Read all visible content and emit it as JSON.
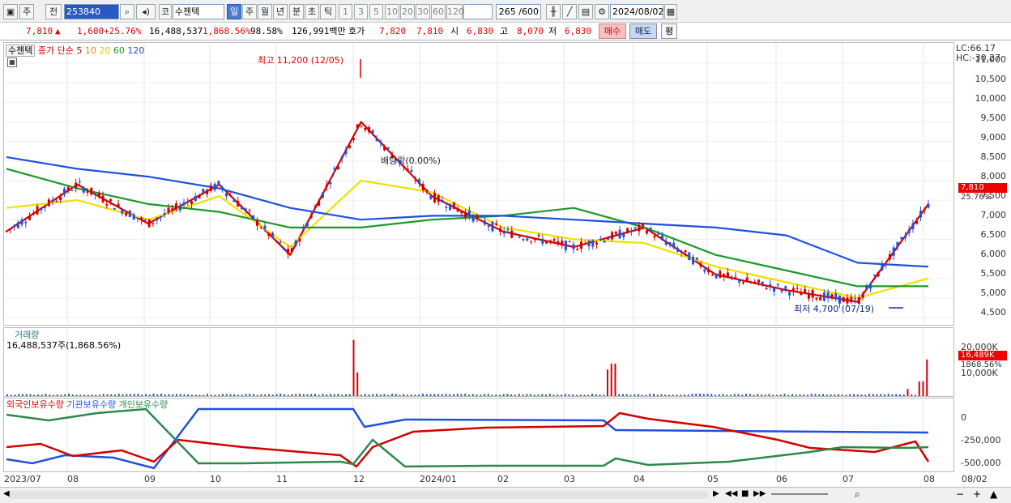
{
  "toolbar": {
    "market_label": "주",
    "prev_label": "전",
    "code_value": "253840",
    "market_type": "코",
    "stock_name": "수젠텍",
    "periods": [
      "일",
      "주",
      "월",
      "년",
      "분",
      "초",
      "틱"
    ],
    "selected_period": "일",
    "intervals": [
      "1",
      "3",
      "5",
      "10",
      "20",
      "30",
      "60",
      "120"
    ],
    "count_display": "265 /600",
    "date_value": "2024/08/02"
  },
  "quote": {
    "price": "7,810",
    "arrow": "▲",
    "change": "1,600",
    "change_pct": "+25.76%",
    "volume": "16,488,537",
    "volume_pct": "1,868.56%",
    "turnover_ratio": "98.58%",
    "amount": "126,991백만",
    "hoga_label": "호가",
    "hoga_bid": "7,820",
    "hoga_ask": "7,810",
    "open_label": "시",
    "open": "6,830",
    "high_label": "고",
    "high": "8,070",
    "low_label": "저",
    "low": "6,830",
    "buy_label": "매수",
    "sell_label": "매도",
    "avg_label": "평"
  },
  "price_panel": {
    "name_tag": "수젠텍",
    "ma_label": "종가 단순",
    "ma_periods": [
      "5",
      "10",
      "20",
      "60",
      "120"
    ],
    "ma_colors": [
      "#d40000",
      "#e08a00",
      "#f0e000",
      "#1a9a2a",
      "#2050e0"
    ],
    "high_note": "최고 11,200 (12/05)",
    "low_note": "최저 4,700 (07/19)",
    "ex_note": "배당락(0.00%)",
    "lc": "LC:66.17",
    "hc": "HC:-30.27",
    "y_ticks": [
      "11,000",
      "10,500",
      "10,000",
      "9,500",
      "9,000",
      "8,500",
      "8,000",
      "7,500",
      "7,000",
      "6,500",
      "6,000",
      "5,500",
      "5,000",
      "4,500"
    ],
    "last_price_tag": "7,810",
    "last_pct_tag": "25.76%"
  },
  "volume_panel": {
    "title": "거래량",
    "value_text": "16,488,537주(1,868.56%)",
    "y_ticks": [
      "20,000K",
      "10,000K"
    ],
    "last_tag": "16,489K",
    "last_pct": "1868.56%"
  },
  "holding_panel": {
    "series": [
      {
        "name": "외국인보유수량",
        "color": "#d40000"
      },
      {
        "name": "기관보유수량",
        "color": "#2050e0"
      },
      {
        "name": "개인보유수량",
        "color": "#2a8a4a"
      }
    ],
    "y_ticks": [
      "0",
      "-250,000",
      "-500,000"
    ]
  },
  "x_axis": [
    "2023/07",
    "08",
    "09",
    "10",
    "11",
    "12",
    "2024/01",
    "02",
    "03",
    "04",
    "05",
    "06",
    "07",
    "08"
  ],
  "x_axis_right": "08/02",
  "chart_data": {
    "type": "line",
    "title": "",
    "note": "daily candlestick with moving averages (values approximate)",
    "ylim": [
      4500,
      11200
    ],
    "x": [
      "2023/07",
      "08",
      "09",
      "10",
      "11",
      "12",
      "2024/01",
      "02",
      "03",
      "04",
      "05",
      "06",
      "07",
      "08"
    ],
    "series": [
      {
        "name": "5",
        "values": [
          6700,
          7900,
          6900,
          7900,
          6100,
          9500,
          7600,
          6700,
          6300,
          6800,
          5600,
          5200,
          4900,
          7400
        ]
      },
      {
        "name": "20",
        "values": [
          7300,
          7500,
          7000,
          7600,
          6300,
          8000,
          7700,
          6800,
          6500,
          6400,
          5800,
          5400,
          5000,
          5500
        ]
      },
      {
        "name": "60",
        "values": [
          8300,
          7800,
          7400,
          7200,
          6800,
          6800,
          7000,
          7100,
          7300,
          6800,
          6100,
          5700,
          5300,
          5300
        ]
      },
      {
        "name": "120",
        "values": [
          8600,
          8300,
          8100,
          7800,
          7300,
          7000,
          7100,
          7100,
          7000,
          6900,
          6800,
          6600,
          5900,
          5800
        ]
      }
    ]
  }
}
